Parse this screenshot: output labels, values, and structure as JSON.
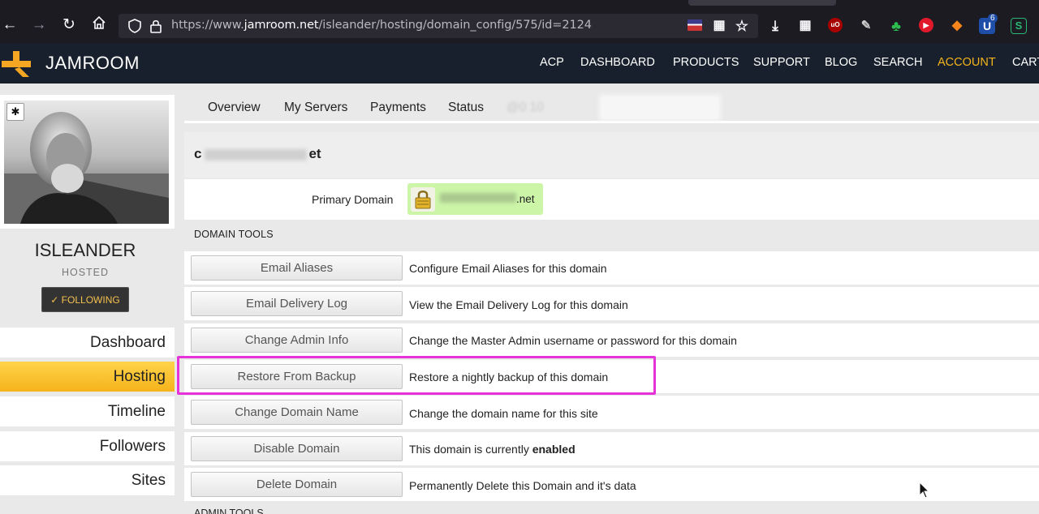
{
  "browser": {
    "url_prefix": "https://www.",
    "url_host": "jamroom.net",
    "url_path": "/isleander/hosting/domain_config/575/id=2124",
    "back_icon": "arrow-left-icon",
    "forward_icon": "arrow-right-icon",
    "reload_icon": "reload-icon",
    "home_icon": "home-icon",
    "extensions_badge": "6"
  },
  "site": {
    "logo_text": "JAMROOM",
    "nav": [
      "ACP",
      "DASHBOARD",
      "PRODUCTS",
      "SUPPORT",
      "BLOG",
      "SEARCH",
      "ACCOUNT",
      "CART"
    ],
    "active_nav": "ACCOUNT",
    "accent_color": "#f5b31b",
    "header_color": "#17202c"
  },
  "profile": {
    "name": "ISLEANDER",
    "type": "HOSTED",
    "follow_label": "✓ FOLLOWING"
  },
  "sidebar": {
    "items": [
      {
        "label": "Dashboard"
      },
      {
        "label": "Hosting"
      },
      {
        "label": "Timeline"
      },
      {
        "label": "Followers"
      },
      {
        "label": "Sites"
      }
    ],
    "active": "Hosting"
  },
  "tabs": {
    "items": [
      "Overview",
      "My Servers",
      "Payments",
      "Status"
    ],
    "blurred": "@0          10"
  },
  "domain": {
    "title_start": "c",
    "title_end": "et",
    "primary_label": "Primary Domain",
    "primary_value_end": ".net"
  },
  "tools": {
    "section_label": "DOMAIN TOOLS",
    "rows": [
      {
        "button": "Email Aliases",
        "desc": "Configure Email Aliases for this domain"
      },
      {
        "button": "Email Delivery Log",
        "desc": "View the Email Delivery Log for this domain"
      },
      {
        "button": "Change Admin Info",
        "desc": "Change the Master Admin username or password for this domain"
      },
      {
        "button": "Restore From Backup",
        "desc": "Restore a nightly backup of this domain"
      },
      {
        "button": "Change Domain Name",
        "desc": "Change the domain name for this site"
      },
      {
        "button": "Disable Domain",
        "desc_prefix": "This domain is currently ",
        "desc_bold": "enabled"
      },
      {
        "button": "Delete Domain",
        "desc": "Permanently Delete this Domain and it's data"
      }
    ],
    "highlighted": "Restore From Backup",
    "highlight_color": "#e533d9"
  },
  "next_section_label": "ADMIN TOOLS"
}
